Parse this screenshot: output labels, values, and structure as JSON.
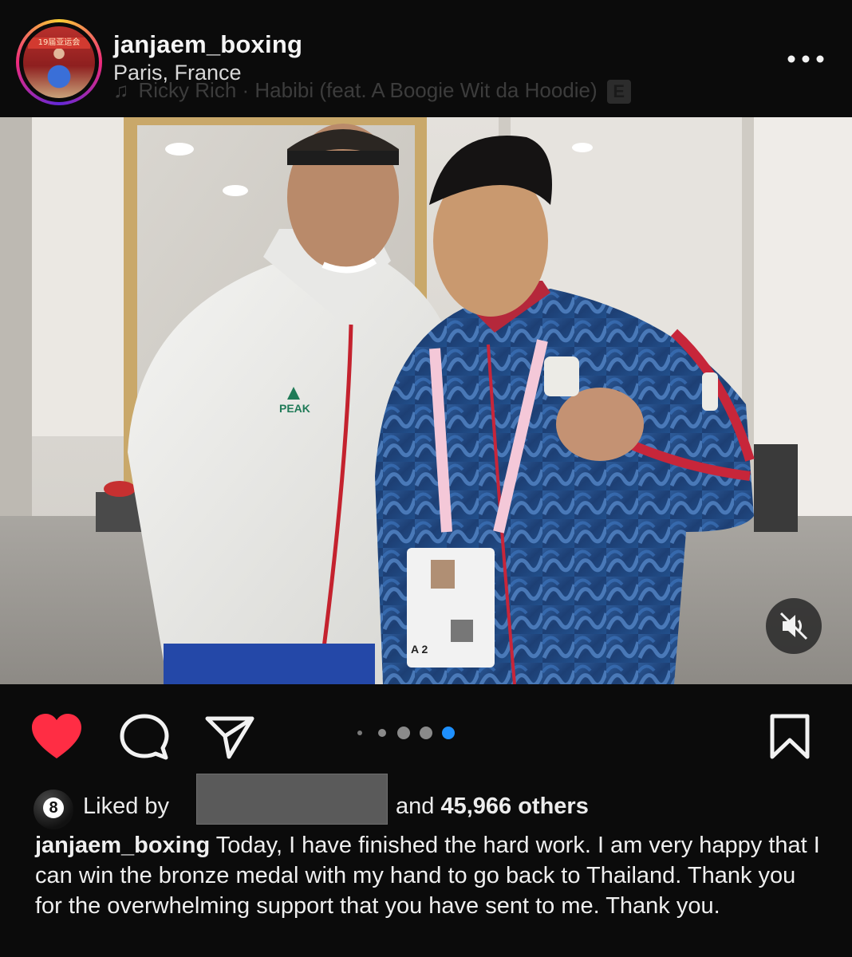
{
  "post_header": {
    "username": "janjaem_boxing",
    "location": "Paris, France",
    "music": {
      "artist": "Ricky Rich",
      "separator": " · ",
      "track": "Habibi (feat. A Boogie Wit da Hoodie)",
      "explicit_label": "E"
    },
    "avatar_banner_text": "19届亚运会",
    "more_icon": "more-horizontal-icon"
  },
  "media": {
    "jacket_logo_text": "PEAK",
    "badge_text": "A 2",
    "carousel_count": 5,
    "carousel_active_index": 4,
    "muted": true,
    "mute_icon": "speaker-muted-icon"
  },
  "actions": {
    "liked": true,
    "like_icon": "heart-icon",
    "comment_icon": "comment-icon",
    "share_icon": "send-icon",
    "save_icon": "bookmark-icon",
    "like_color": "#ff2d44"
  },
  "likes": {
    "prefix": "Liked by",
    "suffix": "and",
    "count": "45,966 others",
    "avatar_text": "8"
  },
  "caption": {
    "username": "janjaem_boxing",
    "text": "Today, I have finished the hard work. I am very happy that I can win the bronze medal with my hand to go back to Thailand. Thank you for the overwhelming support that you have sent to me. Thank you."
  }
}
